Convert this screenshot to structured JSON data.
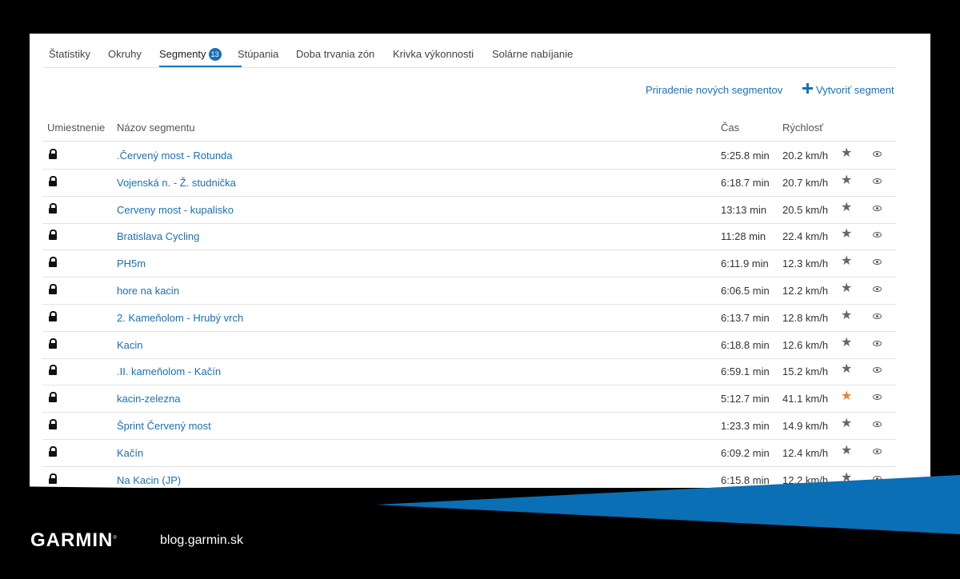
{
  "tabs": [
    {
      "label": "Štatistiky"
    },
    {
      "label": "Okruhy"
    },
    {
      "label": "Segmenty",
      "badge": "13"
    },
    {
      "label": "Stúpania"
    },
    {
      "label": "Doba trvania zón"
    },
    {
      "label": "Krivka výkonnosti"
    },
    {
      "label": "Solárne nabíjanie"
    }
  ],
  "active_tab": "Segmenty",
  "actions": {
    "assign_label": "Priradenie nových segmentov",
    "create_label": "Vytvoriť segment",
    "create_icon": "plus-icon"
  },
  "columns": {
    "rank": "Umiestnenie",
    "name": "Názov segmentu",
    "time": "Čas",
    "speed": "Rýchlosť"
  },
  "segments": [
    {
      "name": ".Červený most - Rotunda",
      "time": "5:25.8 min",
      "speed": "20.2 km/h",
      "favorite": false
    },
    {
      "name": "Vojenská n. - Ž. studnička",
      "time": "6:18.7 min",
      "speed": "20.7 km/h",
      "favorite": false
    },
    {
      "name": "Cerveny most - kupalisko",
      "time": "13:13 min",
      "speed": "20.5 km/h",
      "favorite": false
    },
    {
      "name": "Bratislava Cycling",
      "time": "11:28 min",
      "speed": "22.4 km/h",
      "favorite": false
    },
    {
      "name": "PH5m",
      "time": "6:11.9 min",
      "speed": "12.3 km/h",
      "favorite": false
    },
    {
      "name": "hore na kacin",
      "time": "6:06.5 min",
      "speed": "12.2 km/h",
      "favorite": false
    },
    {
      "name": "2. Kameňolom - Hrubý vrch",
      "time": "6:13.7 min",
      "speed": "12.8 km/h",
      "favorite": false
    },
    {
      "name": "Kacin",
      "time": "6:18.8 min",
      "speed": "12.6 km/h",
      "favorite": false
    },
    {
      "name": ".II. kameňolom - Kačín",
      "time": "6:59.1 min",
      "speed": "15.2 km/h",
      "favorite": false
    },
    {
      "name": "kacin-zelezna",
      "time": "5:12.7 min",
      "speed": "41.1 km/h",
      "favorite": true
    },
    {
      "name": "Šprint Červený most",
      "time": "1:23.3 min",
      "speed": "14.9 km/h",
      "favorite": false
    },
    {
      "name": "Kačín",
      "time": "6:09.2 min",
      "speed": "12.4 km/h",
      "favorite": false
    },
    {
      "name": "Na Kacin (JP)",
      "time": "6:15.8 min",
      "speed": "12.2 km/h",
      "favorite": false
    }
  ],
  "icons": {
    "lock": "lock-icon",
    "star": "star-icon",
    "eye": "eye-icon"
  },
  "colors": {
    "link": "#1a6fb8",
    "favorite_star": "#e8822a",
    "banner_blue": "#0a6fb5",
    "background": "#000000"
  },
  "footer": {
    "brand": "GARMIN",
    "brand_mark": "®",
    "url": "blog.garmin.sk"
  }
}
